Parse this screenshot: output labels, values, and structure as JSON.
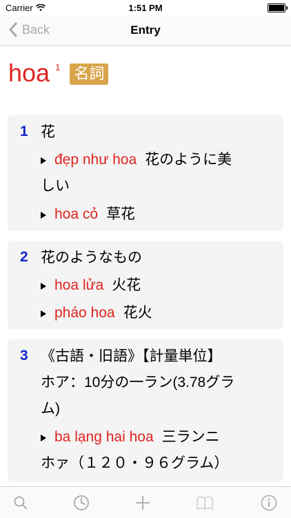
{
  "status": {
    "carrier": "Carrier",
    "time": "1:51 PM"
  },
  "nav": {
    "back_label": "Back",
    "title": "Entry"
  },
  "entry": {
    "headword": "hoa",
    "superscript": "1",
    "pos": "名詞"
  },
  "senses": [
    {
      "number": "1",
      "gloss": [
        "花"
      ],
      "examples": [
        {
          "vi": "đẹp như hoa",
          "ja_1": "花のように美",
          "ja_2": "しい"
        },
        {
          "vi": "hoa cỏ",
          "ja_1": "草花",
          "ja_2": ""
        }
      ]
    },
    {
      "number": "2",
      "gloss": [
        "花のようなもの"
      ],
      "examples": [
        {
          "vi": "hoa lửa",
          "ja_1": "火花",
          "ja_2": ""
        },
        {
          "vi": "pháo hoa",
          "ja_1": "花火",
          "ja_2": ""
        }
      ]
    },
    {
      "number": "3",
      "gloss": [
        "《古語・旧語》【計量単位】",
        "ホア：10分の一ラン(3.78グラ",
        "ム)"
      ],
      "examples": [
        {
          "vi": "ba lạng hai hoa",
          "ja_1": "三ランニ",
          "ja_2": "ホァ（１２０・９６グラム）"
        }
      ]
    }
  ],
  "icons": {
    "search": "search-icon",
    "history": "clock-icon",
    "add": "plus-icon",
    "bookmarks": "book-icon",
    "info": "info-icon",
    "back": "chevron-left-icon",
    "wifi": "wifi-icon",
    "battery": "battery-icon"
  },
  "colors": {
    "headword": "#e0231f",
    "number": "#1026c6",
    "pos_badge": "#d8a54b",
    "card_bg": "#f4f4f4",
    "inactive": "#a9a9a9"
  }
}
